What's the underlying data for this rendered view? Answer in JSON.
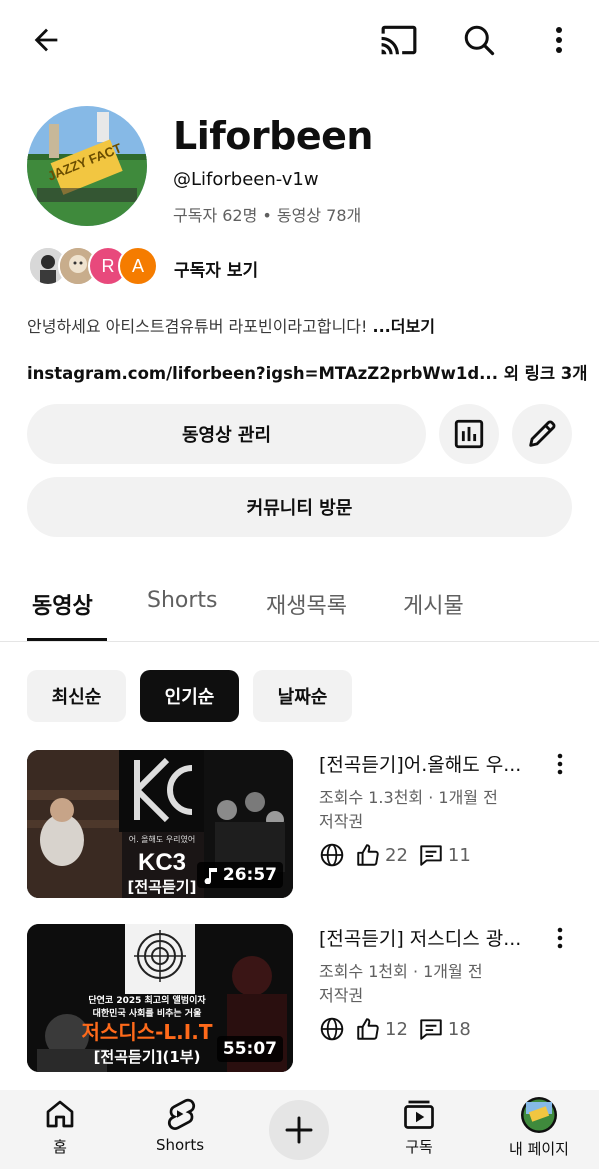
{
  "channel": {
    "name": "Liforbeen",
    "handle": "@Liforbeen-v1w",
    "stats": "구독자 62명 • 동영상 78개",
    "subscribers_label": "구독자 보기",
    "description": "안녕하세요 아티스트겸유튜버 라포빈이라고합니다! ",
    "description_more": "...더보기",
    "link": "instagram.com/liforbeen?igsh=MTAzZ2prbWw1d...",
    "link_more": " 외 링크 3개",
    "subscriber_avatars": [
      {
        "letter": "",
        "color": "#c9c9c9"
      },
      {
        "letter": "",
        "color": "#b79a7a"
      },
      {
        "letter": "R",
        "color": "#e8497c"
      },
      {
        "letter": "A",
        "color": "#f57c00"
      }
    ],
    "avatar_text": "JAZZY FACT"
  },
  "actions": {
    "manage_videos": "동영상 관리",
    "visit_community": "커뮤니티 방문"
  },
  "tabs": [
    {
      "label": "동영상",
      "active": true
    },
    {
      "label": "Shorts",
      "active": false
    },
    {
      "label": "재생목록",
      "active": false
    },
    {
      "label": "게시물",
      "active": false
    }
  ],
  "chips": [
    {
      "label": "최신순",
      "active": false
    },
    {
      "label": "인기순",
      "active": true
    },
    {
      "label": "날짜순",
      "active": false
    }
  ],
  "videos": [
    {
      "title": "[전곡듣기]어.올해도 우...",
      "views": "조회수 1.3천회 · 1개월 전",
      "license": "저작권",
      "likes": "22",
      "comments": "11",
      "duration": "26:57",
      "thumb_big": "KC3",
      "thumb_sub": "[전곡듣기]",
      "thumb_small": "어. 올해도 우리였어"
    },
    {
      "title": "[전곡듣기] 저스디스 광...",
      "views": "조회수 1천회 · 1개월 전",
      "license": "저작권",
      "likes": "12",
      "comments": "18",
      "duration": "55:07",
      "thumb_line1": "단연코 2025 최고의 앨범이자",
      "thumb_line2": "대한민국 사회를 비추는 거울",
      "thumb_big": "저스디스-L.I.T",
      "thumb_sub": "[전곡듣기](1부)"
    }
  ],
  "nav": {
    "home": "홈",
    "shorts": "Shorts",
    "subscriptions": "구독",
    "you": "내 페이지"
  }
}
